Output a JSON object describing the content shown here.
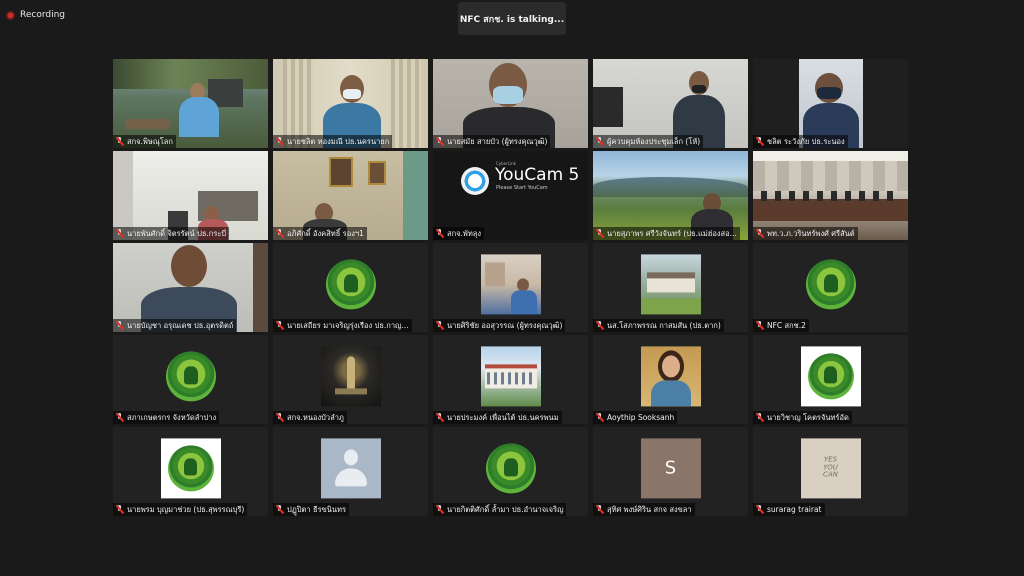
{
  "status": {
    "recording_label": "Recording",
    "speaker_text": "NFC สกช. is  talking..."
  },
  "participants": [
    {
      "name": "สกจ.พิษณุโลก",
      "muted": true,
      "type": "video"
    },
    {
      "name": "นายชลิต ทองมณี ปธ.นครนายก",
      "muted": true,
      "type": "video"
    },
    {
      "name": "นายสมัย สายบัว (ผู้ทรงคุณวุฒิ)",
      "muted": true,
      "type": "video"
    },
    {
      "name": "ผู้ควบคุมห้องประชุมเล็ก (โห้)",
      "muted": true,
      "type": "video"
    },
    {
      "name": "ชลิต ระวังภัย ปธ.ระนอง",
      "muted": true,
      "type": "video"
    },
    {
      "name": "นายพันศักดิ์ จิตรรัตน์ ปธ.กระบี่",
      "muted": true,
      "type": "video"
    },
    {
      "name": "อภิศักดิ์ อังคสิทธิ์ รองฯ1",
      "muted": true,
      "type": "video"
    },
    {
      "name": "สกจ.พัทลุง",
      "muted": true,
      "type": "youcam",
      "youcam_title": "YouCam 5",
      "youcam_sub": "Please Start YouCam",
      "youcam_brand": "CyberLink"
    },
    {
      "name": "นายสุภาพร ศรีวังจันทร์ (ปธ.แม่ฮ่องสอ...",
      "muted": true,
      "type": "video"
    },
    {
      "name": "พท.ว.ภ.วรินทร์พงศ์ ศรีสันต์",
      "muted": true,
      "type": "video"
    },
    {
      "name": "นายบัญชา อรุณเดช ปธ.อุตรดิตถ์",
      "muted": true,
      "type": "video"
    },
    {
      "name": "นายเสถียร มาเจริญรุ่งเรือง ปธ.กาญ...",
      "muted": true,
      "type": "logo"
    },
    {
      "name": "นายศิริชัย ออสุวรรณ (ผู้ทรงคุณวุฒิ)",
      "muted": true,
      "type": "photo"
    },
    {
      "name": "นส.โสภาพรรณ กาสมสัน (ปธ.ตาก)",
      "muted": true,
      "type": "photo"
    },
    {
      "name": "NFC สกช.2",
      "muted": true,
      "type": "logo"
    },
    {
      "name": "สภาเกษตรกร จังหวัดลำปาง",
      "muted": true,
      "type": "logo"
    },
    {
      "name": "สกจ.หนองบัวลำภู",
      "muted": true,
      "type": "photo"
    },
    {
      "name": "นายประมงค์ เพื่อนไต้ ปธ.นครพนม",
      "muted": true,
      "type": "photo"
    },
    {
      "name": "Aoythip Sooksanh",
      "muted": true,
      "type": "photo"
    },
    {
      "name": "นายวิชาญ โคตรจันทร์อัด",
      "muted": true,
      "type": "logo"
    },
    {
      "name": "นายพรม บุญมาช่วย (ปธ.สุพรรณบุรี)",
      "muted": true,
      "type": "logo"
    },
    {
      "name": "ปฏูปิตา ธีรขนินทร",
      "muted": true,
      "type": "avatar"
    },
    {
      "name": "นายกิตติศักดิ์ ล้ำมา ปธ.อำนาจเจริญ",
      "muted": true,
      "type": "logo"
    },
    {
      "name": "สุทิศ พงษ์ศิริน สกจ สงขลา",
      "muted": true,
      "type": "initial",
      "initial": "S"
    },
    {
      "name": "surarag trairat",
      "muted": true,
      "type": "yc",
      "yc_text": "YES\nYOU\nCAN"
    }
  ],
  "colors": {
    "background": "#1a1a1a",
    "tile": "#222222",
    "mute_slash": "#e0302a",
    "recording_dot": "#c4312d"
  },
  "icons": {
    "recording": "recording-dot-icon",
    "mute": "mic-muted-icon"
  }
}
